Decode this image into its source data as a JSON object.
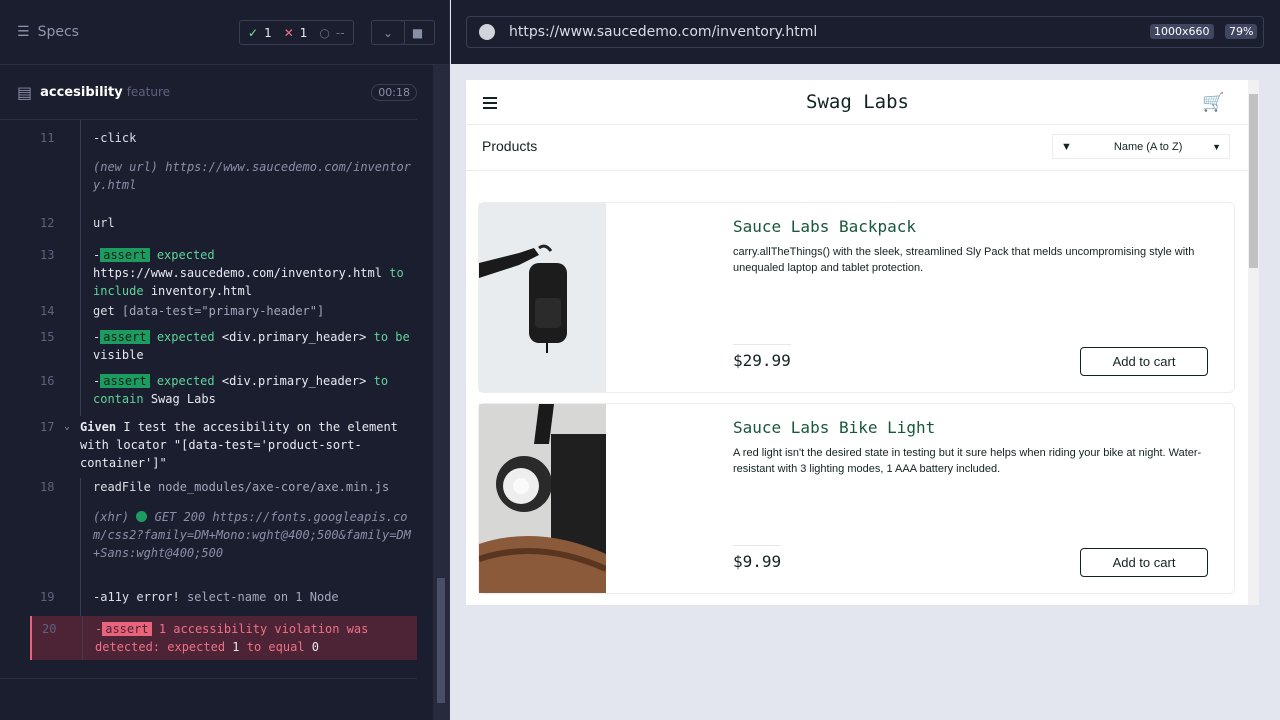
{
  "sidebar": {
    "title": "Specs",
    "stats": {
      "passed": "1",
      "failed": "1",
      "pending": "--"
    },
    "feature": {
      "name": "accesibility",
      "kind": "feature",
      "time": "00:18"
    }
  },
  "log": {
    "l11": {
      "num": "11",
      "cmd": "-click"
    },
    "l11b": {
      "label": "(new url)",
      "value": "https://www.saucedemo.com/inventory.html"
    },
    "l12": {
      "num": "12",
      "cmd": "url"
    },
    "l13": {
      "num": "13",
      "tag": "assert",
      "text": "expected",
      "val1": "https://www.saucedemo.com/inventory.html",
      "mid": "to include",
      "val2": "inventory.html"
    },
    "l14": {
      "num": "14",
      "cmd": "get",
      "arg": "[data-test=\"primary-header\"]"
    },
    "l15": {
      "num": "15",
      "tag": "assert",
      "text": "expected",
      "val1": "<div.primary_header>",
      "mid": "to be",
      "val2": "visible"
    },
    "l16": {
      "num": "16",
      "tag": "assert",
      "text": "expected",
      "val1": "<div.primary_header>",
      "mid": "to contain",
      "val2": "Swag Labs"
    },
    "l17": {
      "num": "17",
      "kw": "Given",
      "text": "I test the accesibility on the element with locator \"[data-test='product-sort-container']\""
    },
    "l18": {
      "num": "18",
      "cmd": "readFile",
      "arg": "node_modules/axe-core/axe.min.js"
    },
    "l18b": {
      "label": "(xhr)",
      "status": "GET 200",
      "url": "https://fonts.googleapis.com/css2?family=DM+Mono:wght@400;500&family=DM+Sans:wght@400;500"
    },
    "l19": {
      "num": "19",
      "cmd": "-a11y error!",
      "arg": "select-name on 1 Node"
    },
    "l20": {
      "num": "20",
      "tag": "assert",
      "text": "1 accessibility violation was detected: expected",
      "v1": "1",
      "mid": "to equal",
      "v2": "0"
    }
  },
  "browser": {
    "url": "https://www.saucedemo.com/inventory.html",
    "viewport": "1000x660",
    "zoom": "79%"
  },
  "app": {
    "brand": "Swag Labs",
    "section": "Products",
    "sort_value": "Name (A to Z)",
    "products": [
      {
        "name": "Sauce Labs Backpack",
        "desc": "carry.allTheThings() with the sleek, streamlined Sly Pack that melds uncompromising style with unequaled laptop and tablet protection.",
        "price": "$29.99",
        "button": "Add to cart"
      },
      {
        "name": "Sauce Labs Bike Light",
        "desc": "A red light isn't the desired state in testing but it sure helps when riding your bike at night. Water-resistant with 3 lighting modes, 1 AAA battery included.",
        "price": "$9.99",
        "button": "Add to cart"
      }
    ]
  },
  "colors": {
    "pass": "#1d9c62",
    "fail": "#e8647a",
    "brand_text": "#18583a"
  }
}
